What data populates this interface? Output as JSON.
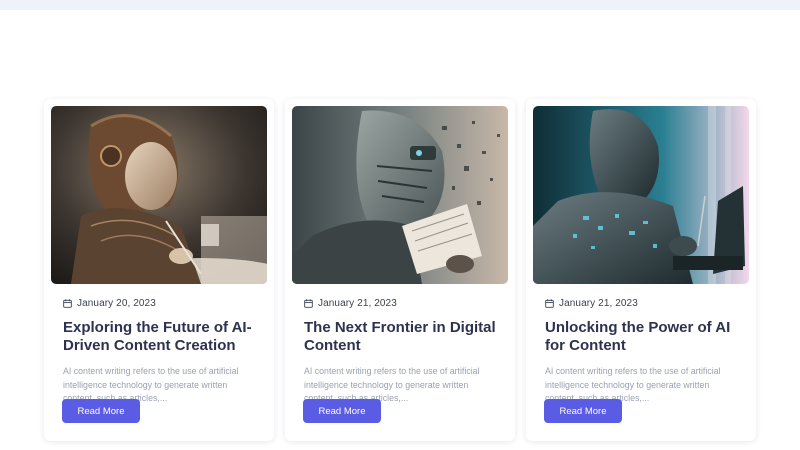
{
  "posts": [
    {
      "date": "January 20, 2023",
      "title": "Exploring the Future of AI-Driven Content Creation",
      "excerpt": "AI content writing refers to the use of artificial intelligence technology to generate written content, such as articles,...",
      "button_label": "Read More",
      "image_icon": "robot-woman-writing-image",
      "image_colors": [
        "#2a2623",
        "#8a6e55",
        "#d9c4ad"
      ]
    },
    {
      "date": "January 21, 2023",
      "title": "The Next Frontier in Digital Content",
      "excerpt": "AI content writing refers to the use of artificial intelligence technology to generate written content, such as articles,...",
      "button_label": "Read More",
      "image_icon": "robot-reading-paper-image",
      "image_colors": [
        "#2b3235",
        "#6d7a7c",
        "#d6c7b8"
      ]
    },
    {
      "date": "January 21, 2023",
      "title": "Unlocking the Power of AI for Content",
      "excerpt": "AI content writing refers to the use of artificial intelligence technology to generate written content, such as articles,...",
      "button_label": "Read More",
      "image_icon": "robot-at-computer-image",
      "image_colors": [
        "#12363f",
        "#2f8fa0",
        "#ff6fae"
      ]
    }
  ],
  "theme": {
    "accent": "#5b5ce4",
    "title_color": "#2d3250",
    "excerpt_color": "#9aa1b3",
    "top_band": "#eef2fb"
  }
}
